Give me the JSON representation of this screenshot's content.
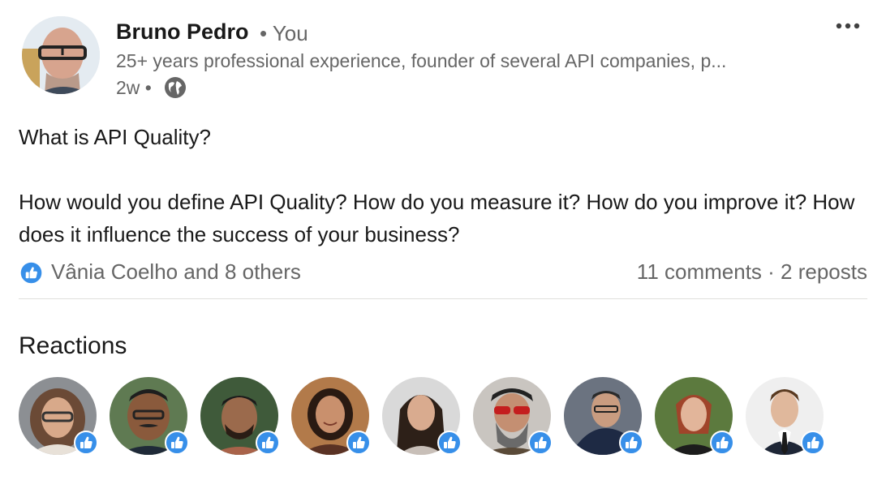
{
  "post": {
    "author": {
      "name": "Bruno Pedro",
      "relation": "• You",
      "headline": "25+ years professional experience, founder of several API companies, p...",
      "time": "2w •"
    },
    "text": {
      "line1": "What is API Quality?",
      "line2": "How would you define API Quality? How do you measure it? How do you improve it? How does it influence the success of your business?"
    },
    "social": {
      "reactors": "Vânia Coelho and 8 others",
      "comments": "11 comments",
      "separator": " · ",
      "reposts": "2 reposts"
    }
  },
  "reactions": {
    "title": "Reactions",
    "people": [
      {
        "icon": "avatar-woman-glasses"
      },
      {
        "icon": "avatar-man-mustache"
      },
      {
        "icon": "avatar-man-beard"
      },
      {
        "icon": "avatar-woman-smiling"
      },
      {
        "icon": "avatar-woman-long-hair"
      },
      {
        "icon": "avatar-man-red-sunglasses"
      },
      {
        "icon": "avatar-man-suit"
      },
      {
        "icon": "avatar-woman-red-hair"
      },
      {
        "icon": "avatar-man-tie"
      }
    ]
  },
  "colors": {
    "like_blue": "#378fe9",
    "muted_text": "#666666",
    "primary_text": "#191919"
  }
}
